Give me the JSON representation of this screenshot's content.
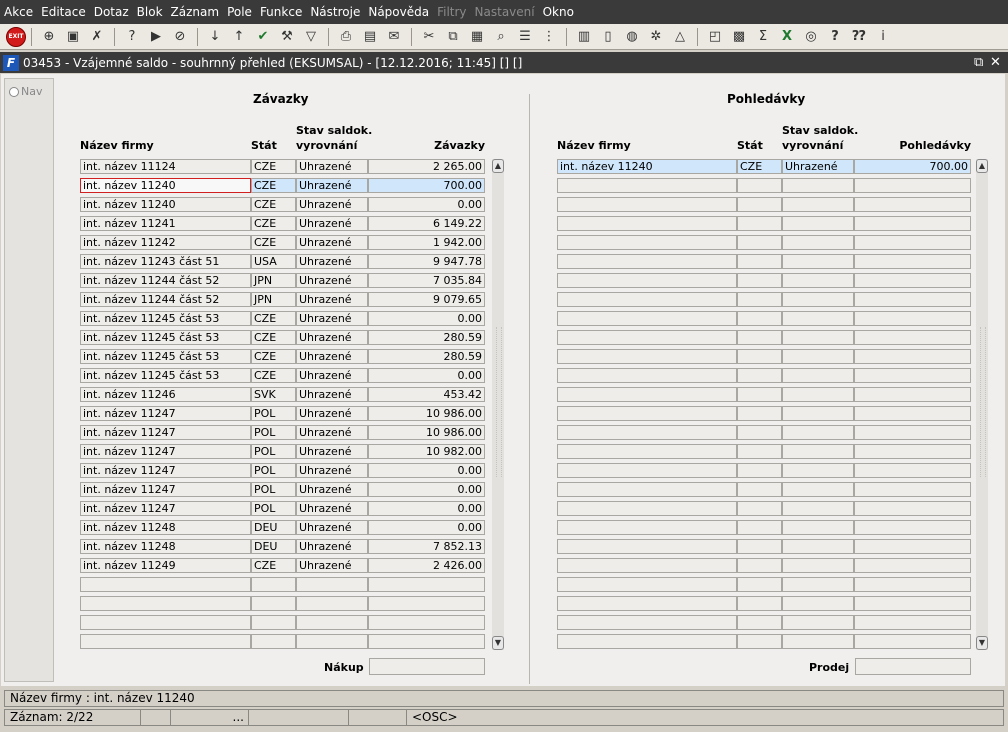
{
  "menu": [
    "Akce",
    "Editace",
    "Dotaz",
    "Blok",
    "Záznam",
    "Pole",
    "Funkce",
    "Nástroje",
    "Nápověda",
    "Filtry",
    "Nastavení",
    "Okno"
  ],
  "menu_disabled": [
    "Filtry",
    "Nastavení"
  ],
  "toolbar": {
    "exit_label": "EXIT",
    "icons": [
      "new-record-icon",
      "save-icon",
      "delete-record-icon",
      "sep",
      "query-enter-icon",
      "query-execute-icon",
      "query-cancel-icon",
      "sep",
      "sort-ascending-icon",
      "sort-descending-icon",
      "accept-icon",
      "tools-icon",
      "filter-icon",
      "sep",
      "print-icon",
      "print-preview-icon",
      "send-mail-icon",
      "sep",
      "cut-icon",
      "copy-icon",
      "paste-icon",
      "search-icon",
      "list-icon",
      "tree-icon",
      "sep",
      "clipboard-icon",
      "document-icon",
      "globe-icon",
      "settings-wheel-icon",
      "warning-icon",
      "sep",
      "chart-icon",
      "calendar-icon",
      "sum-icon",
      "excel-icon",
      "export-icon",
      "help-icon",
      "help-context-icon",
      "info-icon"
    ]
  },
  "window": {
    "title": "03453 - Vzájemné saldo - souhrnný přehled (EKSUMSAL) - [12.12.2016; 11:45] [] []",
    "restore_symbol": "⧉",
    "close_symbol": "✕"
  },
  "nav_label": "Nav",
  "left": {
    "title": "Závazky",
    "headers": {
      "name": "Název firmy",
      "country": "Stát",
      "state_line1": "Stav saldok.",
      "state_line2": "vyrovnání",
      "amount": "Závazky"
    },
    "rows": [
      {
        "name": "int. název 11124",
        "country": "CZE",
        "state": "Uhrazené",
        "amount": "2 265.00"
      },
      {
        "name": "int. název 11240",
        "country": "CZE",
        "state": "Uhrazené",
        "amount": "700.00"
      },
      {
        "name": "int. název 11240",
        "country": "CZE",
        "state": "Uhrazené",
        "amount": "0.00"
      },
      {
        "name": "int. název 11241",
        "country": "CZE",
        "state": "Uhrazené",
        "amount": "6 149.22"
      },
      {
        "name": "int. název 11242",
        "country": "CZE",
        "state": "Uhrazené",
        "amount": "1 942.00"
      },
      {
        "name": "int. název 11243 část 51",
        "country": "USA",
        "state": "Uhrazené",
        "amount": "9 947.78"
      },
      {
        "name": "int. název 11244 část 52",
        "country": "JPN",
        "state": "Uhrazené",
        "amount": "7 035.84"
      },
      {
        "name": "int. název 11244 část 52",
        "country": "JPN",
        "state": "Uhrazené",
        "amount": "9 079.65"
      },
      {
        "name": "int. název 11245 část 53",
        "country": "CZE",
        "state": "Uhrazené",
        "amount": "0.00"
      },
      {
        "name": "int. název 11245 část 53",
        "country": "CZE",
        "state": "Uhrazené",
        "amount": "280.59"
      },
      {
        "name": "int. název 11245 část 53",
        "country": "CZE",
        "state": "Uhrazené",
        "amount": "280.59"
      },
      {
        "name": "int. název 11245 část 53",
        "country": "CZE",
        "state": "Uhrazené",
        "amount": "0.00"
      },
      {
        "name": "int. název 11246",
        "country": "SVK",
        "state": "Uhrazené",
        "amount": "453.42"
      },
      {
        "name": "int. název 11247",
        "country": "POL",
        "state": "Uhrazené",
        "amount": "10 986.00"
      },
      {
        "name": "int. název 11247",
        "country": "POL",
        "state": "Uhrazené",
        "amount": "10 986.00"
      },
      {
        "name": "int. název 11247",
        "country": "POL",
        "state": "Uhrazené",
        "amount": "10 982.00"
      },
      {
        "name": "int. název 11247",
        "country": "POL",
        "state": "Uhrazené",
        "amount": "0.00"
      },
      {
        "name": "int. název 11247",
        "country": "POL",
        "state": "Uhrazené",
        "amount": "0.00"
      },
      {
        "name": "int. název 11247",
        "country": "POL",
        "state": "Uhrazené",
        "amount": "0.00"
      },
      {
        "name": "int. název 11248",
        "country": "DEU",
        "state": "Uhrazené",
        "amount": "0.00"
      },
      {
        "name": "int. název 11248",
        "country": "DEU",
        "state": "Uhrazené",
        "amount": "7 852.13"
      },
      {
        "name": "int. název 11249",
        "country": "CZE",
        "state": "Uhrazené",
        "amount": "2 426.00"
      },
      {
        "name": "",
        "country": "",
        "state": "",
        "amount": ""
      },
      {
        "name": "",
        "country": "",
        "state": "",
        "amount": ""
      },
      {
        "name": "",
        "country": "",
        "state": "",
        "amount": ""
      },
      {
        "name": "",
        "country": "",
        "state": "",
        "amount": ""
      }
    ],
    "selected_row": 1,
    "footer_label": "Nákup",
    "footer_value": ""
  },
  "right": {
    "title": "Pohledávky",
    "headers": {
      "name": "Název firmy",
      "country": "Stát",
      "state_line1": "Stav saldok.",
      "state_line2": "vyrovnání",
      "amount": "Pohledávky"
    },
    "rows": [
      {
        "name": "int. název 11240",
        "country": "CZE",
        "state": "Uhrazené",
        "amount": "700.00"
      }
    ],
    "total_rows": 26,
    "selected_row": 0,
    "footer_label": "Prodej",
    "footer_value": ""
  },
  "status": {
    "field_info": "Název firmy : int. název 11240",
    "record": "Záznam: 2/22",
    "seg3": "...",
    "mode": "<OSC>"
  }
}
